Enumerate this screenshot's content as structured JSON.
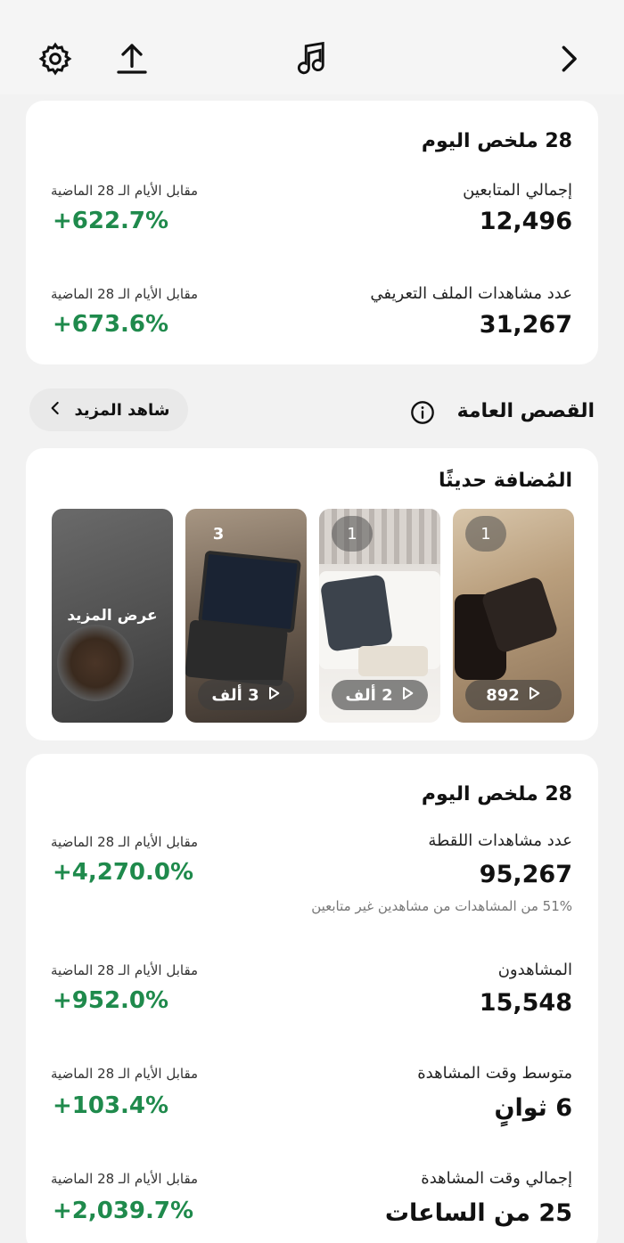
{
  "summary1": {
    "title": "28 ملخص اليوم",
    "metrics": [
      {
        "label": "إجمالي المتابعين",
        "value": "12,496",
        "cmp_label": "مقابل الأيام الـ 28 الماضية",
        "cmp_value": "+622.7%"
      },
      {
        "label": "عدد مشاهدات الملف التعريفي",
        "value": "31,267",
        "cmp_label": "مقابل الأيام الـ 28 الماضية",
        "cmp_value": "+673.6%"
      }
    ]
  },
  "stories_header": {
    "title": "القصص العامة",
    "see_more": "شاهد المزيد"
  },
  "recent": {
    "title": "المُضافة حديثًا",
    "stories": [
      {
        "badge": "1",
        "views": "892"
      },
      {
        "badge": "1",
        "views": "2 ألف"
      },
      {
        "badge": "3",
        "views": "3 ألف"
      },
      {
        "more_label": "عرض المزيد"
      }
    ]
  },
  "summary2": {
    "title": "28 ملخص اليوم",
    "metrics": [
      {
        "label": "عدد مشاهدات اللقطة",
        "value": "95,267",
        "sub": "51% من المشاهدات من مشاهدين غير متابعين",
        "cmp_label": "مقابل الأيام الـ 28 الماضية",
        "cmp_value": "+4,270.0%"
      },
      {
        "label": "المشاهدون",
        "value": "15,548",
        "cmp_label": "مقابل الأيام الـ 28 الماضية",
        "cmp_value": "+952.0%"
      },
      {
        "label": "متوسط وقت المشاهدة",
        "value": "6 ثوانٍ",
        "cmp_label": "مقابل الأيام الـ 28 الماضية",
        "cmp_value": "+103.4%"
      },
      {
        "label": "إجمالي وقت المشاهدة",
        "value": "25 من الساعات",
        "cmp_label": "مقابل الأيام الـ 28 الماضية",
        "cmp_value": "+2,039.7%"
      }
    ]
  },
  "icons": {
    "settings": "gear-icon",
    "share": "upload-icon",
    "music": "music-note-icon",
    "back": "chevron-right-icon",
    "info": "info-icon",
    "see_more_chevron": "chevron-left-icon",
    "play": "play-icon"
  },
  "colors": {
    "positive": "#1f8a4c",
    "card": "#ffffff",
    "background": "#f2f2f2"
  }
}
